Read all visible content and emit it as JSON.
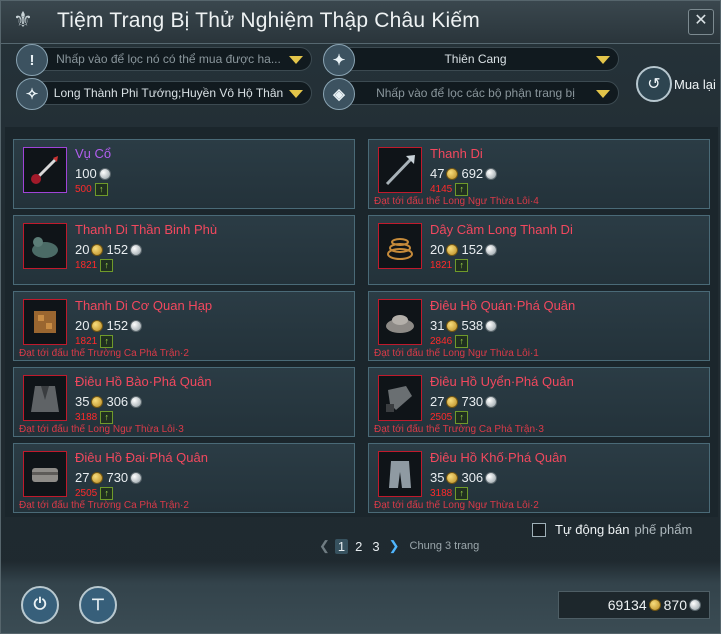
{
  "window": {
    "title": "Tiệm Trang Bị Thử Nghiệm Thập Châu Kiếm"
  },
  "filters": {
    "name_search": {
      "placeholder": "Nhấp vào để lọc nó có thể  mua được ha..."
    },
    "realm_select": {
      "value": "Thiên Cang"
    },
    "class_select": {
      "value": "Long Thành Phi Tướng;Huyền Vô Hộ Thân"
    },
    "part_select": {
      "placeholder": "Nhấp vào để lọc các bộ phận trang bị"
    }
  },
  "buyback": {
    "label": "Mua lại"
  },
  "items": [
    {
      "name": "Vụ Cổ",
      "rarity": "purple",
      "gold": "",
      "silver": "100",
      "score": "500",
      "req": "",
      "icon": "whip-weapon-icon"
    },
    {
      "name": "Thanh Di",
      "rarity": "red",
      "gold": "47",
      "silver": "692",
      "score": "4145",
      "req": "Đạt tới đấu thế Long Ngư Thừa Lôi·4",
      "icon": "halberd-weapon-icon"
    },
    {
      "name": "Thanh Di Thần Binh Phù",
      "rarity": "red",
      "gold": "20",
      "silver": "152",
      "score": "1821",
      "req": "",
      "icon": "beast-talisman-icon"
    },
    {
      "name": "Dây Cầm Long Thanh Di",
      "rarity": "red",
      "gold": "20",
      "silver": "152",
      "score": "1821",
      "req": "",
      "icon": "coiled-cord-icon"
    },
    {
      "name": "Thanh Di Cơ Quan Hạp",
      "rarity": "red",
      "gold": "20",
      "silver": "152",
      "score": "1821",
      "req": "Đạt tới đấu thế Trường Ca Phá Trận·2",
      "icon": "mechanism-box-icon"
    },
    {
      "name": "Điêu Hồ Quán·Phá Quân",
      "rarity": "red",
      "gold": "31",
      "silver": "538",
      "score": "2846",
      "req": "Đạt tới đấu thế Long Ngư Thừa Lôi·1",
      "icon": "crown-helmet-icon"
    },
    {
      "name": "Điêu Hồ Bào·Phá Quân",
      "rarity": "red",
      "gold": "35",
      "silver": "306",
      "score": "3188",
      "req": "Đạt tới đấu thế Long Ngư Thừa Lôi·3",
      "icon": "robe-armor-icon"
    },
    {
      "name": "Điêu Hồ Uyển·Phá Quân",
      "rarity": "red",
      "gold": "27",
      "silver": "730",
      "score": "2505",
      "req": "Đạt tới đấu thế Trường Ca Phá Trận·3",
      "icon": "gauntlet-icon"
    },
    {
      "name": "Điêu Hồ Đai·Phá Quân",
      "rarity": "red",
      "gold": "27",
      "silver": "730",
      "score": "2505",
      "req": "Đạt tới đấu thế Trường Ca Phá Trận·2",
      "icon": "belt-icon"
    },
    {
      "name": "Điêu Hồ Khố·Phá Quân",
      "rarity": "red",
      "gold": "35",
      "silver": "306",
      "score": "3188",
      "req": "Đạt tới đấu thế Long Ngư Thừa Lôi·2",
      "icon": "trousers-icon"
    }
  ],
  "auto_sell": {
    "label1": "Tự động bán",
    "label2": "phế phẩm",
    "checked": false
  },
  "pagination": {
    "pages": [
      "1",
      "2",
      "3"
    ],
    "current": "1",
    "total_label": "Chung 3 trang"
  },
  "wallet": {
    "gold": "69134",
    "silver": "870"
  },
  "colors": {
    "item_red": "#f2485e",
    "item_purple": "#b35ef0",
    "score_red": "#ff2a2a",
    "accent_gold": "#e3c54a"
  }
}
